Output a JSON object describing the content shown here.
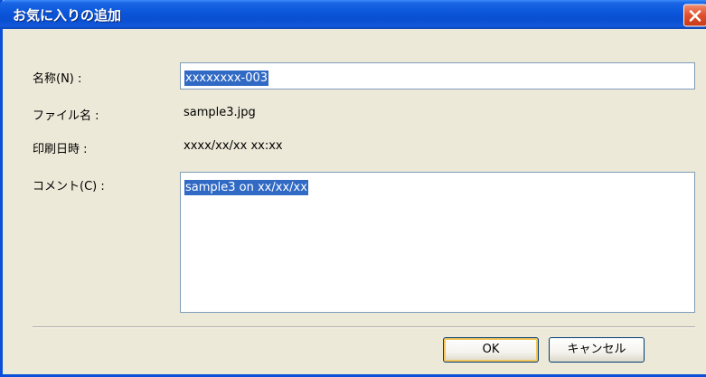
{
  "dialog": {
    "title": "お気に入りの追加"
  },
  "fields": {
    "name_label": "名称(N) :",
    "name_value": "xxxxxxxx-003",
    "file_label": "ファイル名 :",
    "file_value": "sample3.jpg",
    "print_label": "印刷日時 :",
    "print_value": "xxxx/xx/xx xx:xx",
    "comment_label": "コメント(C) :",
    "comment_value": "sample3 on xx/xx/xx"
  },
  "buttons": {
    "ok_label": "OK",
    "cancel_label": "キャンセル"
  },
  "colors": {
    "titlebar": "#0a55d9",
    "selection": "#316ac5",
    "close_button": "#e0502d",
    "dialog_bg": "#ece9d8"
  },
  "icons": {
    "close": "close-icon"
  }
}
